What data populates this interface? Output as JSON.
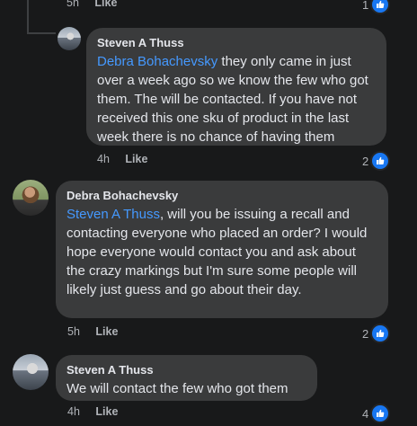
{
  "top_meta": {
    "time": "5h",
    "like": "Like",
    "reaction_count": "1"
  },
  "comments": [
    {
      "author": "Steven A Thuss",
      "mention": "Debra Bohachevsky",
      "text": "they only came in just over a week ago so we know the few who got them. The will be contacted. If you have not received this one sku of product in the last week there is no chance of having them",
      "time": "4h",
      "like": "Like",
      "reaction_count": "2"
    },
    {
      "author": "Debra Bohachevsky",
      "mention": "Steven A Thuss",
      "text": ", will you be issuing a recall and contacting everyone who placed an order? I would hope everyone would contact you and ask about the crazy markings but I'm sure some people will likely just guess and go about their day.",
      "time": "5h",
      "like": "Like",
      "reaction_count": "2"
    },
    {
      "author": "Steven A Thuss",
      "text": "We will contact the few who got them",
      "time": "4h",
      "like": "Like",
      "reaction_count": "4"
    }
  ],
  "colors": {
    "background": "#18191a",
    "bubble": "#3a3b3c",
    "mention": "#4599ff",
    "like_badge": "#1877f2"
  },
  "icons": {
    "reaction": "thumbs-up-icon"
  }
}
